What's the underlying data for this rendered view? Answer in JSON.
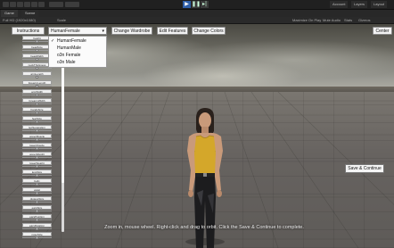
{
  "editor": {
    "menu_right": [
      "Account",
      "Layers",
      "Layout"
    ],
    "tabs": [
      "Game",
      "Scene"
    ],
    "toolbar_left": [
      "Full HD (1920x1080)",
      "Scale"
    ],
    "toolbar_right": [
      "Maximize On Play",
      "Mute Audio",
      "Stats",
      "Gizmos"
    ]
  },
  "game": {
    "buttons": {
      "instructions": "Instructions",
      "change_wardrobe": "Change Wardrobe",
      "edit_features": "Edit Features",
      "change_colors": "Change Colors",
      "center": "Center",
      "save_continue": "Save & Continue"
    },
    "body_dropdown": {
      "selected": "HumanFemale",
      "options": [
        "HumanFemale",
        "HumanMale",
        "o3n Female",
        "o3n Male"
      ]
    },
    "sliders": [
      {
        "label": "height",
        "value": 0.5
      },
      {
        "label": "headSize",
        "value": 0.5
      },
      {
        "label": "headWidth",
        "value": 0.5
      },
      {
        "label": "neckThickness",
        "value": 0.5
      },
      {
        "label": "armLength",
        "value": 0.5
      },
      {
        "label": "forearmLength",
        "value": 0.5
      },
      {
        "label": "armWidth",
        "value": 0.5
      },
      {
        "label": "forearmWidth",
        "value": 0.5
      },
      {
        "label": "handsSize",
        "value": 0.5
      },
      {
        "label": "feetSize",
        "value": 0.5
      },
      {
        "label": "legSeparation",
        "value": 0.5
      },
      {
        "label": "upperMuscle",
        "value": 0.5
      },
      {
        "label": "lowerMuscle",
        "value": 0.5
      },
      {
        "label": "upperWeight",
        "value": 0.5
      },
      {
        "label": "lowerWeight",
        "value": 0.5
      },
      {
        "label": "legsSize",
        "value": 0.5
      },
      {
        "label": "belly",
        "value": 0.5
      },
      {
        "label": "waist",
        "value": 0.5
      },
      {
        "label": "gluteusSize",
        "value": 0.5
      },
      {
        "label": "earsSize",
        "value": 0.5
      },
      {
        "label": "earsPosition",
        "value": 0.5
      },
      {
        "label": "earsRotation",
        "value": 0.5
      },
      {
        "label": "noseSize",
        "value": 0.5
      }
    ],
    "instruction": "Zoom in, mouse wheel. Right-click and drag to orbit. Click the Save & Continue to complete."
  },
  "colors": {
    "play_active": "#2f5fa8",
    "shirt": "#d4a72a",
    "skin": "#c99a7a"
  }
}
